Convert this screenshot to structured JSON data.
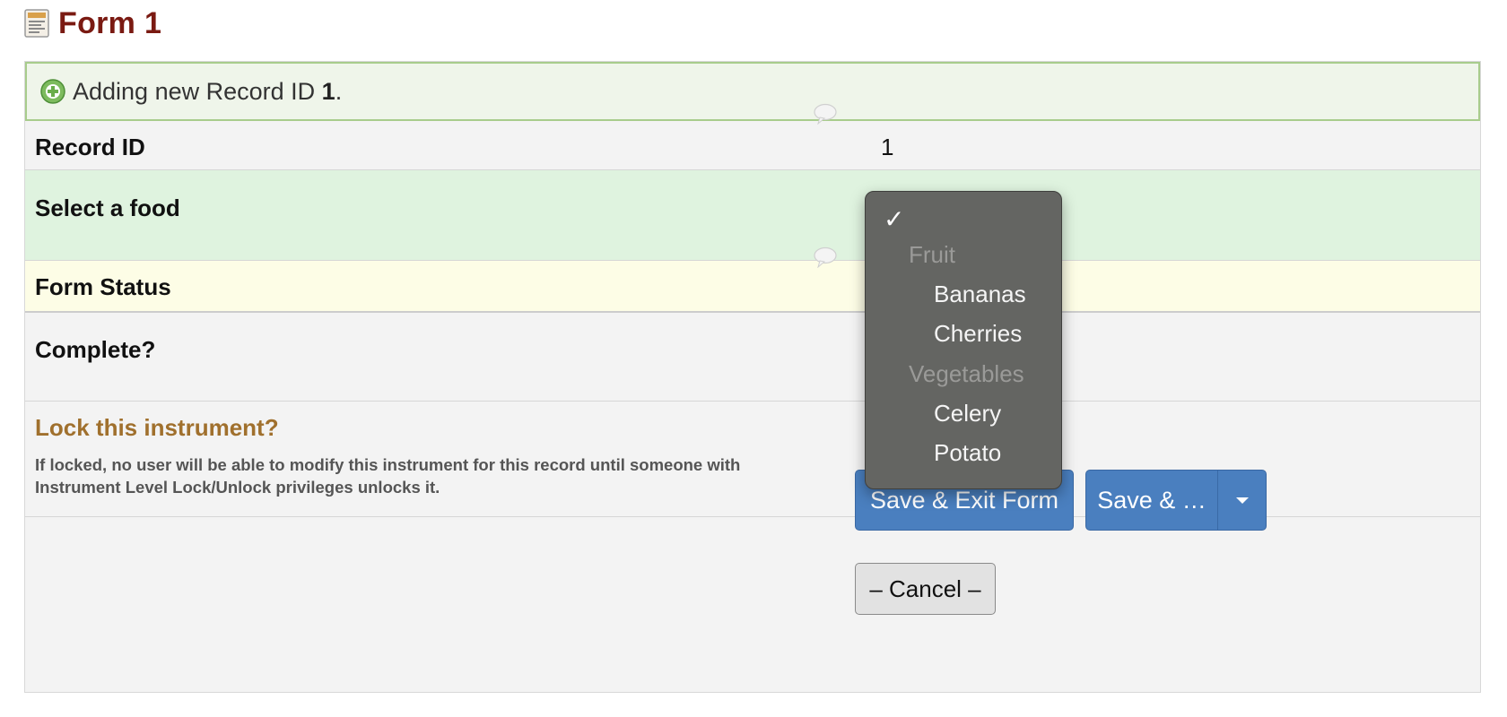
{
  "header": {
    "title": "Form 1",
    "icon": "form-icon"
  },
  "notice": {
    "prefix": "Adding new Record ID ",
    "record_id": "1",
    "suffix": ".",
    "icon": "plus-circle-icon",
    "color": "#a8cc8c"
  },
  "fields": {
    "record_id": {
      "label": "Record ID",
      "value": "1"
    },
    "food": {
      "label": "Select a food"
    },
    "form_status": {
      "label": "Form Status"
    },
    "complete": {
      "label": "Complete?"
    }
  },
  "lock": {
    "title": "Lock this instrument?",
    "description": "If locked, no user will be able to modify this instrument for this record until someone with Instrument Level Lock/Unlock privileges unlocks it."
  },
  "dropdown": {
    "selected_mark": "✓",
    "groups": [
      {
        "label": "Fruit",
        "options": [
          "Bananas",
          "Cherries"
        ]
      },
      {
        "label": "Vegetables",
        "options": [
          "Celery",
          "Potato"
        ]
      }
    ]
  },
  "buttons": {
    "save_exit": "Save & Exit Form",
    "save_more": "Save & …",
    "cancel": "– Cancel –"
  },
  "colors": {
    "title": "#7a1a12",
    "primary_button": "#4a7fbf",
    "lock_title": "#a0702d",
    "food_row": "#dff3df",
    "status_row": "#fdfde6"
  }
}
